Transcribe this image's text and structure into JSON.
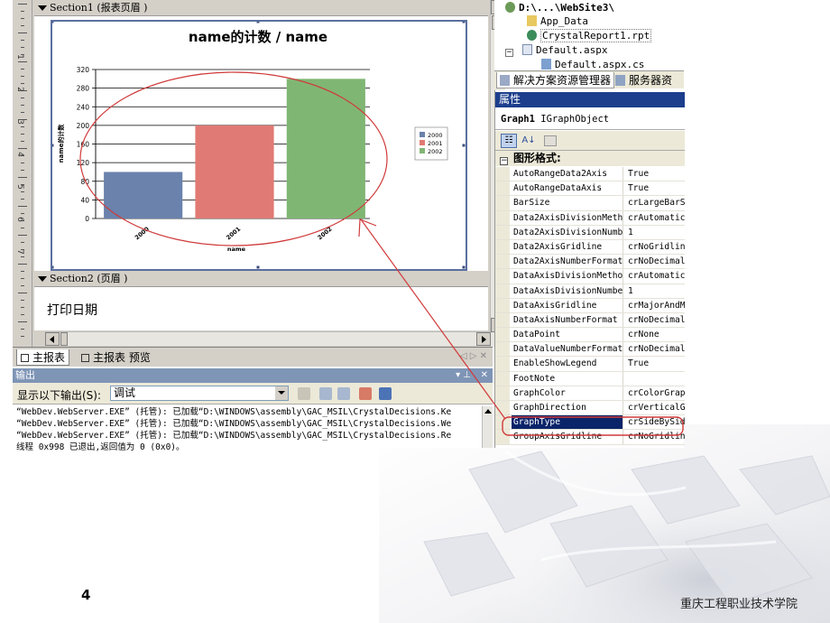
{
  "designer": {
    "section1_label": "Section1 (报表页眉 )",
    "section2_label": "Section2 (页眉 )",
    "footer_field": "打印日期",
    "ruler_numbers": [
      "1",
      "2",
      "3",
      "4",
      "5",
      "6",
      "7"
    ]
  },
  "chart_data": {
    "type": "bar",
    "title": "name的计数 / name",
    "xlabel": "name",
    "ylabel": "name的计数",
    "categories": [
      "2000",
      "2001",
      "2002"
    ],
    "series": [
      {
        "name": "2000",
        "values": [
          100
        ],
        "color": "#6a82ac"
      },
      {
        "name": "2001",
        "values": [
          200
        ],
        "color": "#e07a74"
      },
      {
        "name": "2002",
        "values": [
          300
        ],
        "color": "#80b674"
      }
    ],
    "values": [
      100,
      200,
      300
    ],
    "yticks": [
      0,
      40,
      80,
      120,
      160,
      200,
      240,
      280,
      320
    ],
    "ylim": [
      0,
      320
    ],
    "legend": [
      "2000",
      "2001",
      "2002"
    ],
    "legend_position": "right",
    "grid": true
  },
  "tabs": [
    {
      "label": "主报表"
    },
    {
      "label": "主报表 预览"
    }
  ],
  "output": {
    "title": "输出",
    "show_label": "显示以下输出(S):",
    "selected_source": "调试",
    "lines": [
      "“WebDev.WebServer.EXE” (托管): 已加载“D:\\WINDOWS\\assembly\\GAC_MSIL\\CrystalDecisions.Ke",
      "“WebDev.WebServer.EXE” (托管): 已加载“D:\\WINDOWS\\assembly\\GAC_MSIL\\CrystalDecisions.We",
      "“WebDev.WebServer.EXE” (托管): 已加载“D:\\WINDOWS\\assembly\\GAC_MSIL\\CrystalDecisions.Re",
      "线程 0x998 已退出,返回值为 0 (0x0)。"
    ]
  },
  "solution_explorer": {
    "root": "D:\\...\\WebSite3\\",
    "items": [
      "App_Data",
      "CrystalReport1.rpt",
      "Default.aspx",
      "Default.aspx.cs"
    ],
    "tab_solution": "解决方案资源管理器",
    "tab_server": "服务器资源管"
  },
  "properties": {
    "title": "属性",
    "object_name": "Graph1",
    "object_type": "IGraphObject",
    "category": "图形格式:",
    "rows": [
      {
        "name": "AutoRangeData2Axis",
        "value": "True"
      },
      {
        "name": "AutoRangeDataAxis",
        "value": "True"
      },
      {
        "name": "BarSize",
        "value": "crLargeBarS"
      },
      {
        "name": "Data2AxisDivisionMeth",
        "value": "crAutomatic"
      },
      {
        "name": "Data2AxisDivisionNumb",
        "value": "1"
      },
      {
        "name": "Data2AxisGridline",
        "value": "crNoGridlin"
      },
      {
        "name": "Data2AxisNumberFormat",
        "value": "crNoDecimal"
      },
      {
        "name": "DataAxisDivisionMetho",
        "value": "crAutomatic"
      },
      {
        "name": "DataAxisDivisionNumbe",
        "value": "1"
      },
      {
        "name": "DataAxisGridline",
        "value": "crMajorAndM"
      },
      {
        "name": "DataAxisNumberFormat",
        "value": "crNoDecimal"
      },
      {
        "name": "DataPoint",
        "value": "crNone"
      },
      {
        "name": "DataValueNumberFormat",
        "value": "crNoDecimal"
      },
      {
        "name": "EnableShowLegend",
        "value": "True"
      },
      {
        "name": "FootNote",
        "value": ""
      },
      {
        "name": "GraphColor",
        "value": "crColorGrap"
      },
      {
        "name": "GraphDirection",
        "value": "crVerticalG"
      },
      {
        "name": "GraphType",
        "value": "crSideBySid"
      },
      {
        "name": "GroupAxisGridline",
        "value": "crNoGridlin"
      }
    ],
    "selected_row": "GraphType"
  },
  "slide": {
    "page_number": "4",
    "institution": "重庆工程职业技术学院"
  },
  "colors": {
    "title_bar": "#1c3e8c",
    "annotation": "#d03a3a",
    "frame": "#5a6fa0"
  }
}
